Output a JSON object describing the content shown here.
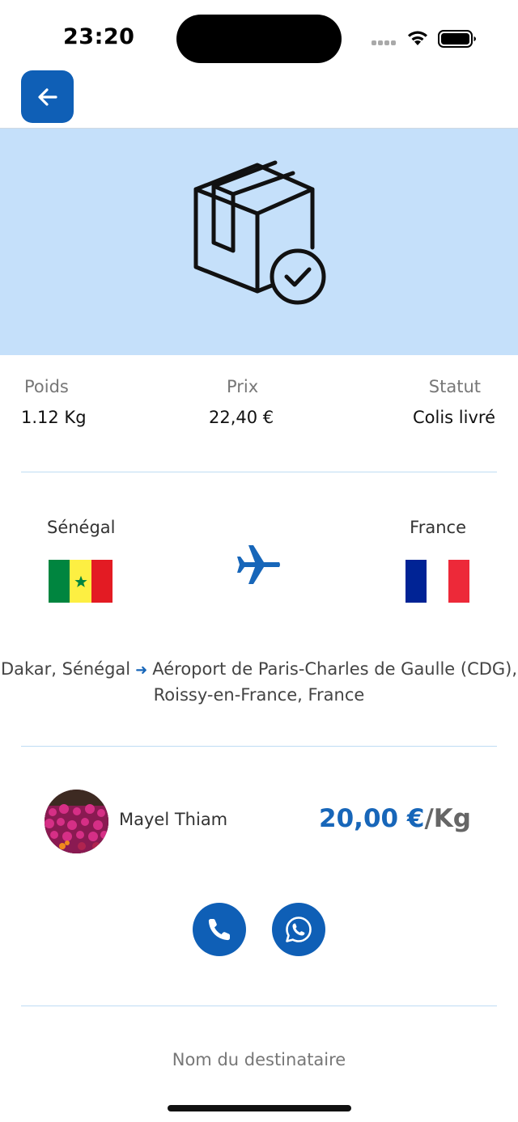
{
  "status_bar": {
    "time": "23:20"
  },
  "colors": {
    "accent": "#0f5fb6",
    "hero_bg": "#c5e0fa",
    "divider": "#bfdcf3",
    "price": "#1766b9"
  },
  "header": {
    "back_icon": "arrow-left-icon"
  },
  "hero": {
    "icon": "package-delivered-icon"
  },
  "stats": {
    "weight_label": "Poids",
    "weight_value": "1.12 Kg",
    "price_label": "Prix",
    "price_value": "22,40 €",
    "status_label": "Statut",
    "status_value": "Colis livré"
  },
  "trip": {
    "origin_country": "Sénégal",
    "destination_country": "France",
    "transport_icon": "airplane-icon",
    "origin_address": "Dakar, Sénégal",
    "destination_address": "Aéroport de Paris-Charles de Gaulle (CDG), Roissy-en-France, France"
  },
  "traveler": {
    "name": "Mayel Thiam",
    "price_amount": "20,00 €",
    "price_unit": "/Kg"
  },
  "contact": {
    "call_icon": "phone-icon",
    "whatsapp_icon": "whatsapp-icon"
  },
  "recipient": {
    "label": "Nom du destinataire"
  }
}
